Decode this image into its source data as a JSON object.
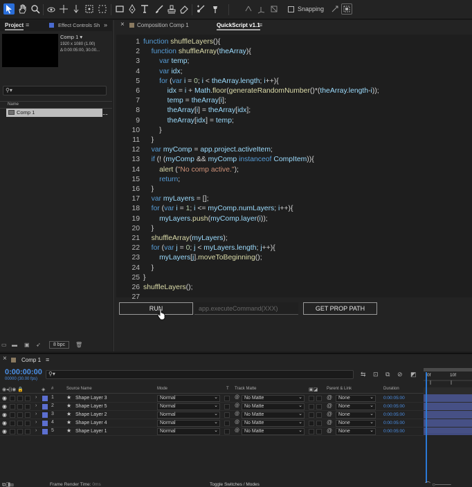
{
  "toolbar": {
    "snapping_label": "Snapping",
    "icons": [
      "selection-tool-icon",
      "hand-tool-icon",
      "zoom-tool-icon",
      "orbit-icon",
      "pan-behind-icon",
      "dolly-icon",
      "anchor-icon",
      "marquee-icon",
      "rectangle-icon",
      "pen-icon",
      "type-icon",
      "brush-icon",
      "clone-stamp-icon",
      "eraser-icon",
      "roto-brush-icon",
      "puppet-icon"
    ]
  },
  "project_panel": {
    "tab_project": "Project",
    "tab_effect_controls": "Effect Controls Sh",
    "comp_name": "Comp 1",
    "comp_dims": "1920 x 1080 (1.00)",
    "comp_duration": "Δ 0:00:05:00, 30.00...",
    "name_column": "Name",
    "item_name": "Comp 1",
    "bpc": "8 bpc"
  },
  "script_panel": {
    "tab_composition": "Composition Comp 1",
    "tab_quickscript": "QuickScript v1.1",
    "run_label": "RUN",
    "command_placeholder": "app.executeCommand(XXX)",
    "prop_path_label": "GET PROP PATH",
    "code_lines": [
      "function shuffleLayers(){",
      "    function shuffleArray(theArray){",
      "        var temp;",
      "        var idx;",
      "        for (var i = 0; i < theArray.length; i++){",
      "            idx = i + Math.floor(generateRandomNumber()*(theArray.length-i));",
      "            temp = theArray[i];",
      "            theArray[i] = theArray[idx];",
      "            theArray[idx] = temp;",
      "        }",
      "    }",
      "    var myComp = app.project.activeItem;",
      "    if (! (myComp && myComp instanceof CompItem)){",
      "        alert (\"No comp active.\");",
      "        return;",
      "    }",
      "    var myLayers = [];",
      "    for (var i = 1; i <= myComp.numLayers; i++){",
      "        myLayers.push(myComp.layer(i));",
      "    }",
      "    shuffleArray(myLayers);",
      "    for (var j = 0; j < myLayers.length; j++){",
      "        myLayers[j].moveToBeginning();",
      "    }",
      "}",
      "shuffleLayers();",
      ""
    ]
  },
  "timeline": {
    "tab_label": "Comp 1",
    "timecode": "0:00:00:00",
    "fps": "00000 (30.00 fps)",
    "ruler_ticks": [
      "0f",
      "10f"
    ],
    "columns": {
      "num": "#",
      "source_name": "Source Name",
      "mode": "Mode",
      "t": "T",
      "track_matte": "Track Matte",
      "parent_link": "Parent & Link",
      "duration": "Duration"
    },
    "layers": [
      {
        "num": "1",
        "name": "Shape Layer 3",
        "mode": "Normal",
        "matte": "No Matte",
        "parent": "None",
        "duration": "0:00:05:00"
      },
      {
        "num": "2",
        "name": "Shape Layer 5",
        "mode": "Normal",
        "matte": "No Matte",
        "parent": "None",
        "duration": "0:00:05:00"
      },
      {
        "num": "3",
        "name": "Shape Layer 2",
        "mode": "Normal",
        "matte": "No Matte",
        "parent": "None",
        "duration": "0:00:05:00"
      },
      {
        "num": "4",
        "name": "Shape Layer 4",
        "mode": "Normal",
        "matte": "No Matte",
        "parent": "None",
        "duration": "0:00:05:00"
      },
      {
        "num": "5",
        "name": "Shape Layer 1",
        "mode": "Normal",
        "matte": "No Matte",
        "parent": "None",
        "duration": "0:00:05:00"
      }
    ],
    "frame_render_label": "Frame Render Time:",
    "frame_render_value": "0ms",
    "toggle_label": "Toggle Switches / Modes"
  },
  "colors": {
    "accent_blue": "#2a6ed9",
    "timecode_blue": "#4b8fe6",
    "layer_label": "#5c6fd0",
    "keyword": "#569cd6",
    "function": "#dcdcaa",
    "variable": "#9cdcfe",
    "string": "#ce9178",
    "number": "#b5cea8"
  }
}
